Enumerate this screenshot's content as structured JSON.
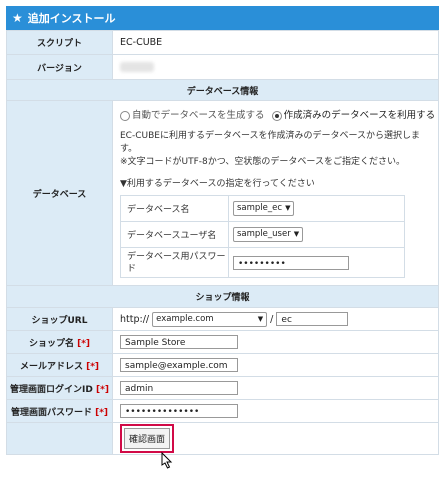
{
  "header": {
    "title": "追加インストール",
    "icon": "star-icon",
    "color": "#2a8fd8"
  },
  "rows": {
    "script_label": "スクリプト",
    "script_value": "EC-CUBE",
    "version_label": "バージョン"
  },
  "db": {
    "section_title": "データベース情報",
    "row_label": "データベース",
    "radio_auto": "自動でデータベースを生成する",
    "radio_existing": "作成済みのデータベースを利用する",
    "note_line1": "EC-CUBEに利用するデータベースを作成済みのデータベースから選択します。",
    "note_line2": "※文字コードがUTF-8かつ、空状態のデータベースをご指定ください。",
    "subheading": "▼利用するデータベースの指定を行ってください",
    "name_label": "データベース名",
    "name_value": "sample_ec",
    "user_label": "データベースユーザ名",
    "user_value": "sample_user",
    "password_label": "データベース用パスワード",
    "password_value": "•••••••••"
  },
  "shop": {
    "section_title": "ショップ情報",
    "url_label": "ショップURL",
    "url_prefix": "http://",
    "url_domain": "example.com",
    "url_slash": "/",
    "url_path": "ec",
    "name_label": "ショップ名",
    "name_value": "Sample Store",
    "email_label": "メールアドレス",
    "email_value": "sample@example.com",
    "login_label": "管理画面ログインID",
    "login_value": "admin",
    "password_label": "管理画面パスワード",
    "password_value": "••••••••••••••",
    "required_mark": "[*]"
  },
  "actions": {
    "confirm_label": "確認画面"
  }
}
